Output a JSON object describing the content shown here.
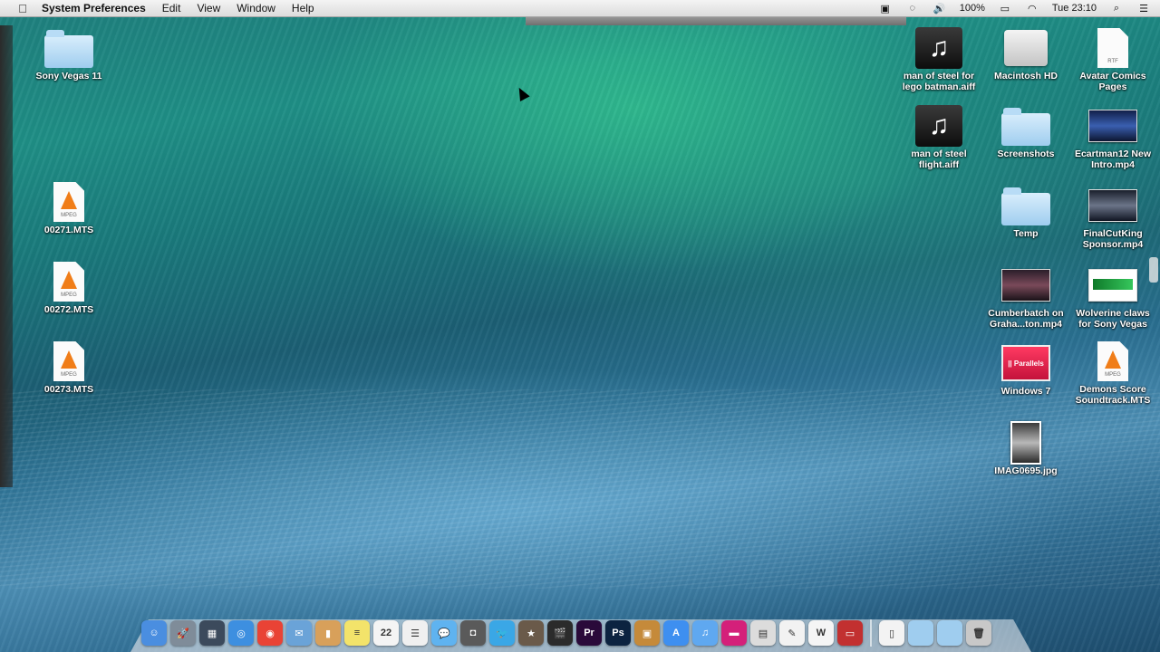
{
  "menubar": {
    "app_name": "System Preferences",
    "menus": [
      "Edit",
      "View",
      "Window",
      "Help"
    ],
    "battery": "100%",
    "clock": "Tue 23:10"
  },
  "desktop": {
    "left_icons": [
      {
        "label": "Sony Vegas 11",
        "icon": "folder-icon"
      },
      {
        "label": "00271.MTS",
        "icon": "vlc-file-icon",
        "tag": "MPEG"
      },
      {
        "label": "00272.MTS",
        "icon": "vlc-file-icon",
        "tag": "MPEG"
      },
      {
        "label": "00273.MTS",
        "icon": "vlc-file-icon",
        "tag": "MPEG"
      }
    ],
    "right_icons": [
      {
        "label": "man of steel for lego batman.aiff",
        "icon": "music-file-icon"
      },
      {
        "label": "Macintosh HD",
        "icon": "hard-drive-icon"
      },
      {
        "label": "Avatar Comics Pages",
        "icon": "rtf-file-icon",
        "tag": "RTF"
      },
      {
        "label": "man of steel flight.aiff",
        "icon": "music-file-icon"
      },
      {
        "label": "Screenshots",
        "icon": "folder-icon"
      },
      {
        "label": "Ecartman12 New Intro.mp4",
        "icon": "video-thumbnail-icon"
      },
      {
        "label": "Temp",
        "icon": "folder-icon"
      },
      {
        "label": "FinalCutKing Sponsor.mp4",
        "icon": "video-thumbnail-icon"
      },
      {
        "label": "Cumberbatch on Graha...ton.mp4",
        "icon": "video-thumbnail-icon"
      },
      {
        "label": "Wolverine claws for Sony Vegas",
        "icon": "video-thumbnail-icon"
      },
      {
        "label": "Windows 7",
        "icon": "parallels-icon",
        "tag": "|| Parallels"
      },
      {
        "label": "Demons Score Soundtrack.MTS",
        "icon": "vlc-file-icon",
        "tag": "MPEG"
      },
      {
        "label": "IMAG0695.jpg",
        "icon": "image-file-icon"
      }
    ]
  },
  "dock": {
    "apps": [
      {
        "name": "finder-icon",
        "color": "#4a8ee0",
        "glyph": "☺"
      },
      {
        "name": "launchpad-icon",
        "color": "#7f8c99",
        "glyph": "🚀"
      },
      {
        "name": "mission-control-icon",
        "color": "#3c4a5c",
        "glyph": "▦"
      },
      {
        "name": "safari-icon",
        "color": "#3d8fe0",
        "glyph": "◎"
      },
      {
        "name": "chrome-icon",
        "color": "#e94335",
        "glyph": "◉"
      },
      {
        "name": "mail-icon",
        "color": "#6aa3d8",
        "glyph": "✉"
      },
      {
        "name": "contacts-icon",
        "color": "#d8a05a",
        "glyph": "▮"
      },
      {
        "name": "notes-icon",
        "color": "#f3e36a",
        "glyph": "≡"
      },
      {
        "name": "calendar-icon",
        "color": "#f4f4f4",
        "glyph": "22"
      },
      {
        "name": "reminders-icon",
        "color": "#f0f0f0",
        "glyph": "☰"
      },
      {
        "name": "messages-icon",
        "color": "#5fb3f0",
        "glyph": "💬"
      },
      {
        "name": "facetime-icon",
        "color": "#5a5a5a",
        "glyph": "◘"
      },
      {
        "name": "twitter-icon",
        "color": "#3aa7e6",
        "glyph": "🐦"
      },
      {
        "name": "imovie-icon",
        "color": "#6a5a4a",
        "glyph": "★"
      },
      {
        "name": "final-cut-icon",
        "color": "#2b2b2b",
        "glyph": "🎬"
      },
      {
        "name": "premiere-icon",
        "color": "#2a0a3a",
        "glyph": "Pr"
      },
      {
        "name": "photoshop-icon",
        "color": "#0c2340",
        "glyph": "Ps"
      },
      {
        "name": "iphoto-icon",
        "color": "#c58a3a",
        "glyph": "▣"
      },
      {
        "name": "app-store-icon",
        "color": "#3e8ff0",
        "glyph": "A"
      },
      {
        "name": "itunes-icon",
        "color": "#5fa8f0",
        "glyph": "♫"
      },
      {
        "name": "parallels-dock-icon",
        "color": "#d4207a",
        "glyph": "▬"
      },
      {
        "name": "preview-icon",
        "color": "#dcdcdc",
        "glyph": "▤"
      },
      {
        "name": "textedit-icon",
        "color": "#f2f2f2",
        "glyph": "✎"
      },
      {
        "name": "writer-icon",
        "color": "#f5f5f5",
        "glyph": "W"
      },
      {
        "name": "photo-booth-icon",
        "color": "#c23030",
        "glyph": "▭"
      }
    ],
    "stacks": [
      {
        "name": "documents-stack-icon",
        "color": "#f3f3f3",
        "glyph": "▯"
      },
      {
        "name": "applications-stack-icon",
        "color": "#9fcdef",
        "glyph": ""
      },
      {
        "name": "downloads-stack-icon",
        "color": "#9fcdef",
        "glyph": ""
      },
      {
        "name": "trash-icon",
        "color": "#c8c8c8",
        "glyph": "🗑"
      }
    ]
  }
}
